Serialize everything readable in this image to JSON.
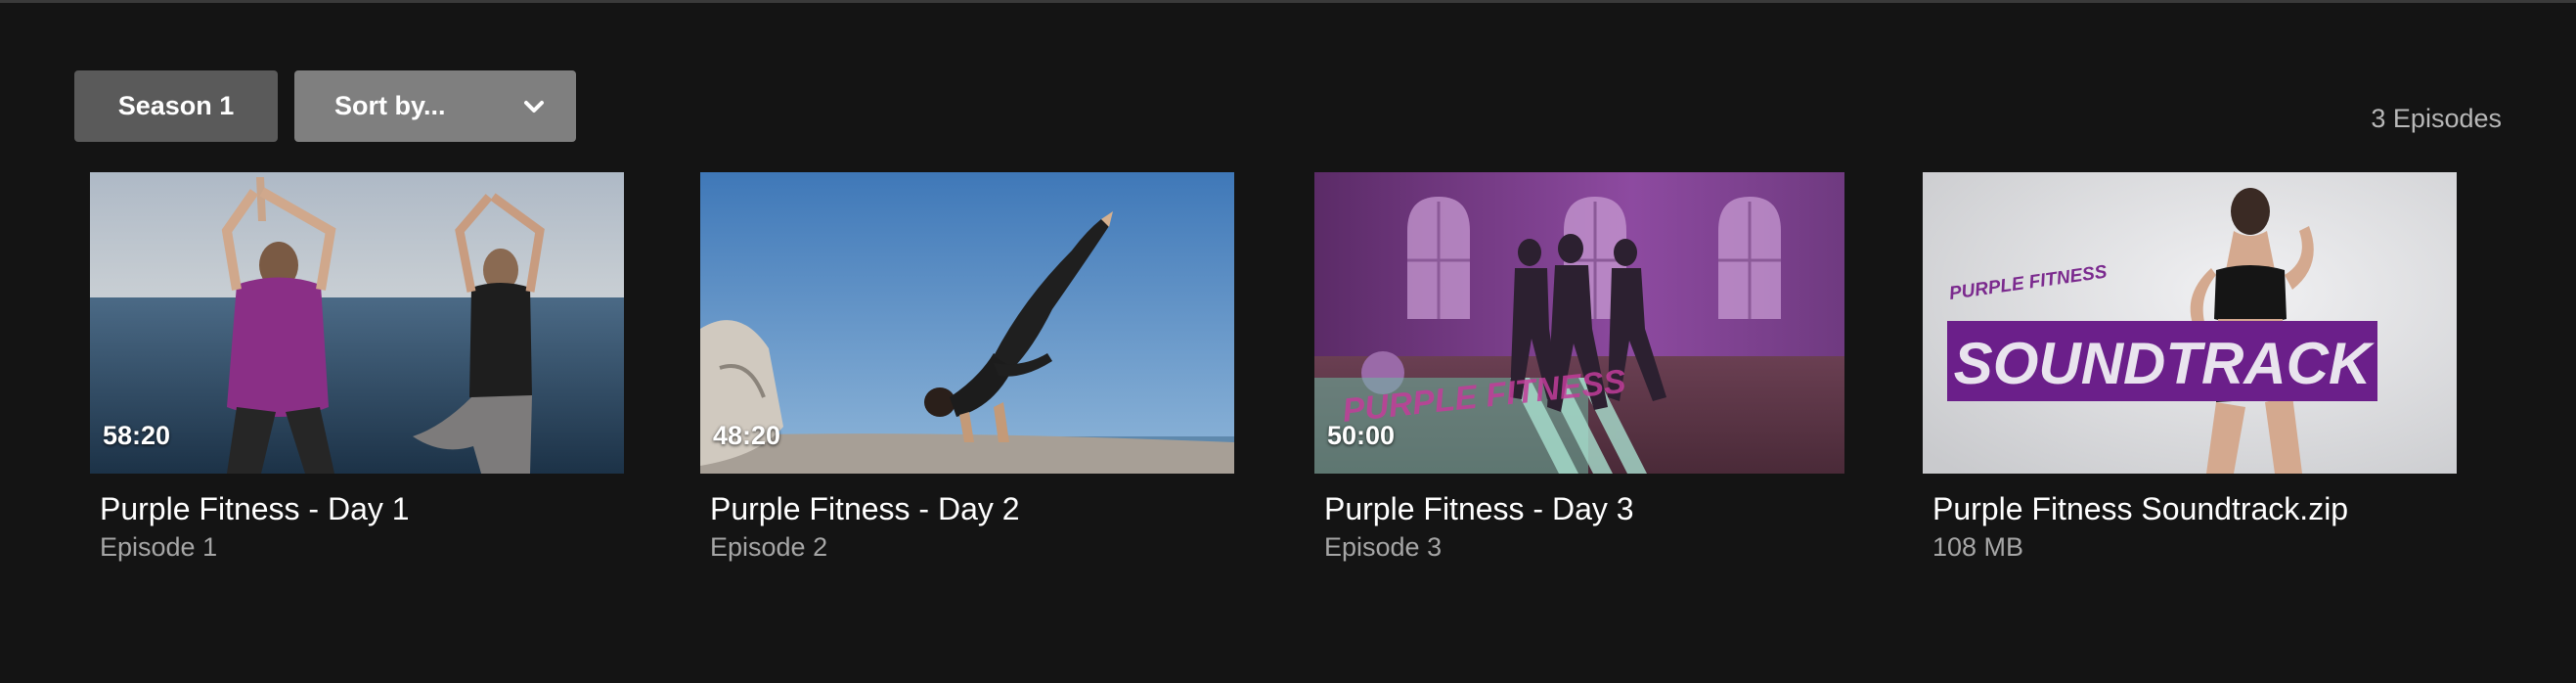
{
  "controls": {
    "season_label": "Season 1",
    "sort_label": "Sort by..."
  },
  "episode_count": "3 Episodes",
  "items": [
    {
      "duration": "58:20",
      "title": "Purple Fitness - Day 1",
      "subtitle": "Episode 1"
    },
    {
      "duration": "48:20",
      "title": "Purple Fitness - Day 2",
      "subtitle": "Episode 2"
    },
    {
      "duration": "50:00",
      "title": "Purple Fitness - Day 3",
      "subtitle": "Episode 3"
    },
    {
      "title": "Purple Fitness Soundtrack.zip",
      "subtitle": "108 MB",
      "brand_text": "PURPLE FITNESS",
      "banner_text": "SOUNDTRACK"
    }
  ],
  "thumb_brand_text": "PURPLE FITNESS",
  "colors": {
    "background": "#141414",
    "season_button": "#5a5a5a",
    "sort_button": "#7f7f7f",
    "brand_purple": "#6b1f8a"
  }
}
